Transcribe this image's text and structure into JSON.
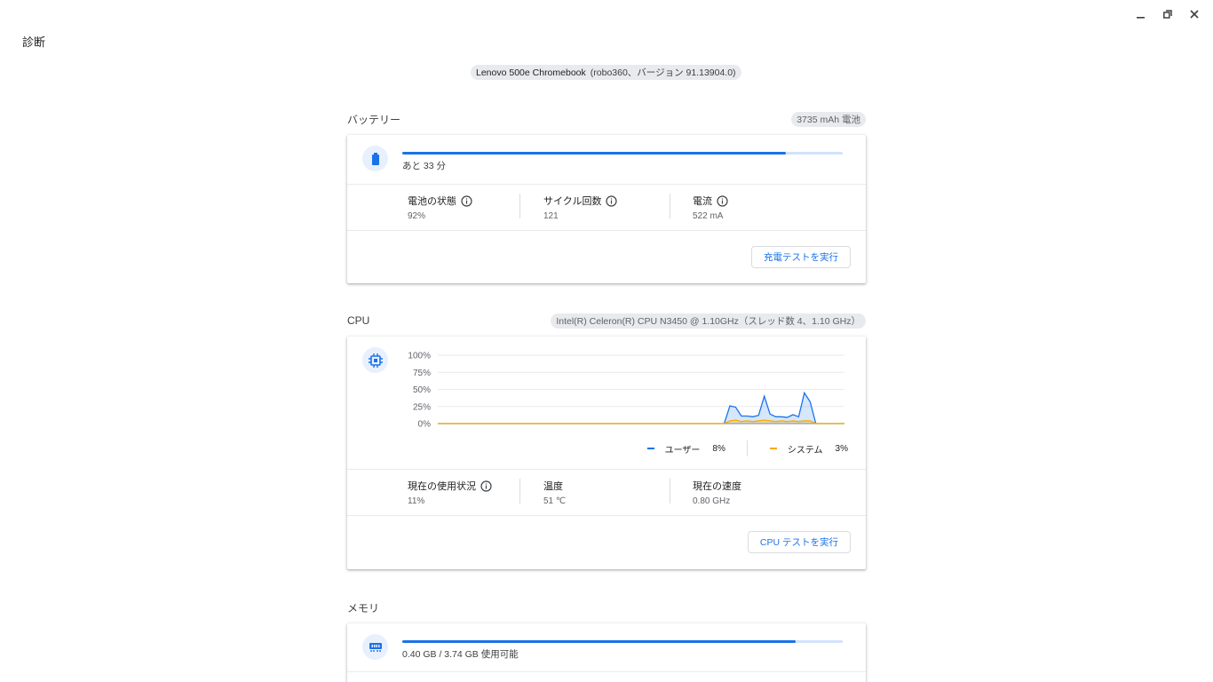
{
  "window": {
    "title": "診断",
    "controls": [
      "minimize-icon",
      "restore-icon",
      "close-icon"
    ]
  },
  "device": {
    "model": "Lenovo 500e Chromebook",
    "detail": "(robo360、バージョン 91.13904.0)"
  },
  "battery": {
    "title": "バッテリー",
    "chip": "3735 mAh 電池",
    "icon": "battery-icon",
    "charge_fraction": 0.87,
    "remaining": "あと 33 分",
    "stats": [
      {
        "label": "電池の状態",
        "value": "92%",
        "info": true
      },
      {
        "label": "サイクル回数",
        "value": "121",
        "info": true
      },
      {
        "label": "電流",
        "value": "522 mA",
        "info": true
      }
    ],
    "button": "充電テストを実行"
  },
  "cpu": {
    "title": "CPU",
    "chip": "Intel(R) Celeron(R) CPU N3450 @ 1.10GHz（スレッド数 4、1.10 GHz）",
    "icon": "cpu-icon",
    "legend": [
      {
        "label": "ユーザー",
        "value": "8%",
        "color": "#1a73e8"
      },
      {
        "label": "システム",
        "value": "3%",
        "color": "#f9ab00"
      }
    ],
    "stats": [
      {
        "label": "現在の使用状況",
        "value": "11%",
        "info": true
      },
      {
        "label": "温度",
        "value": "51 ℃",
        "info": false
      },
      {
        "label": "現在の速度",
        "value": "0.80 GHz",
        "info": false
      }
    ],
    "button": "CPU テストを実行"
  },
  "memory": {
    "title": "メモリ",
    "icon": "memory-icon",
    "used_fraction": 0.893,
    "usage": "0.40 GB / 3.74 GB 使用可能"
  },
  "chart_data": {
    "type": "area",
    "y_ticks": [
      "100%",
      "75%",
      "50%",
      "25%",
      "0%"
    ],
    "ylim": [
      0,
      100
    ],
    "x": [
      0,
      1,
      2,
      3,
      4,
      5,
      6,
      7,
      8,
      9,
      10,
      11,
      12,
      13,
      14,
      15,
      16,
      17,
      18,
      19,
      20,
      21,
      22,
      23,
      24,
      25,
      26,
      27,
      28,
      29,
      30,
      31,
      32,
      33,
      34,
      35,
      36,
      37,
      38,
      39,
      40,
      41,
      42,
      43,
      44,
      45,
      46,
      47,
      48,
      49,
      50,
      51,
      52,
      53,
      54,
      55,
      56,
      57,
      58,
      59,
      60,
      61,
      62,
      63,
      64,
      65,
      66,
      67,
      68,
      69,
      70,
      71
    ],
    "series": [
      {
        "name": "ユーザー",
        "color": "#1a73e8",
        "values": [
          0,
          0,
          0,
          0,
          0,
          0,
          0,
          0,
          0,
          0,
          0,
          0,
          0,
          0,
          0,
          0,
          0,
          0,
          0,
          0,
          0,
          0,
          0,
          0,
          0,
          0,
          0,
          0,
          0,
          0,
          0,
          0,
          0,
          0,
          0,
          0,
          0,
          0,
          0,
          0,
          0,
          0,
          0,
          0,
          0,
          0,
          0,
          0,
          0,
          0,
          0,
          26,
          24,
          11,
          11,
          10,
          12,
          40,
          14,
          10,
          10,
          9,
          13,
          10,
          45,
          32,
          0,
          0,
          0,
          0,
          0,
          0
        ]
      },
      {
        "name": "システム",
        "color": "#f9ab00",
        "values": [
          0,
          0,
          0,
          0,
          0,
          0,
          0,
          0,
          0,
          0,
          0,
          0,
          0,
          0,
          0,
          0,
          0,
          0,
          0,
          0,
          0,
          0,
          0,
          0,
          0,
          0,
          0,
          0,
          0,
          0,
          0,
          0,
          0,
          0,
          0,
          0,
          0,
          0,
          0,
          0,
          0,
          0,
          0,
          0,
          0,
          0,
          0,
          0,
          0,
          0,
          0,
          4,
          5,
          3,
          4,
          3,
          4,
          5,
          4,
          3,
          4,
          3,
          4,
          3,
          4,
          4,
          0,
          0,
          0,
          0,
          0,
          0
        ]
      }
    ]
  }
}
